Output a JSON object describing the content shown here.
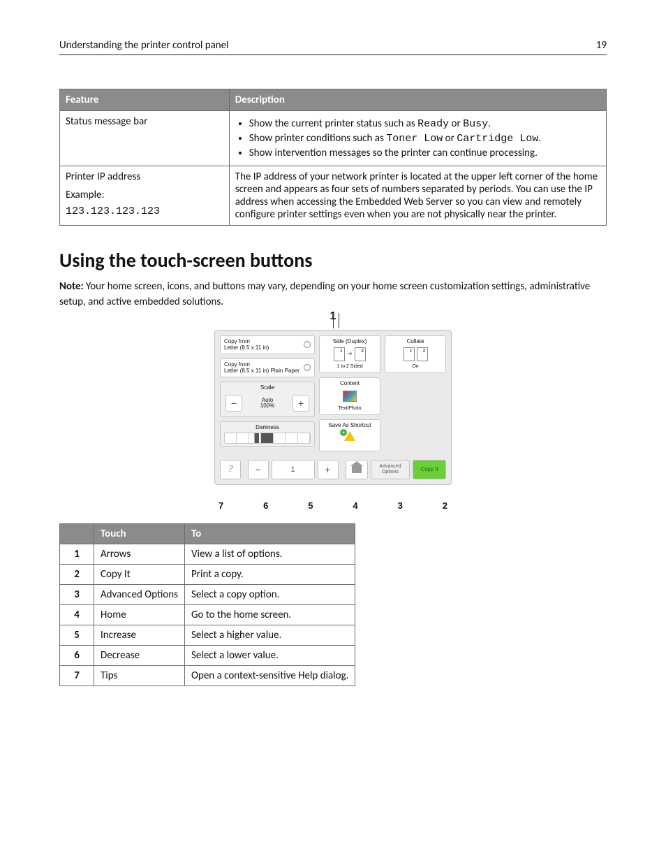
{
  "header": {
    "title": "Understanding the printer control panel",
    "page_no": "19"
  },
  "feature_table": {
    "head": {
      "feature": "Feature",
      "description": "Description"
    },
    "rows": [
      {
        "feature": "Status message bar",
        "bullets": [
          {
            "pre": "Show the current printer status such as ",
            "code1": "Ready",
            "mid": " or ",
            "code2": "Busy",
            "post": "."
          },
          {
            "pre": "Show printer conditions such as ",
            "code1": "Toner Low",
            "mid": " or ",
            "code2": "Cartridge Low",
            "post": "."
          },
          {
            "pre": "Show intervention messages so the printer can continue processing.",
            "code1": "",
            "mid": "",
            "code2": "",
            "post": ""
          }
        ]
      },
      {
        "feature_line1": "Printer IP address",
        "feature_line2": "Example:",
        "feature_code": "123.123.123.123",
        "desc": "The IP address of your network printer is located at the upper left corner of the home screen and appears as four sets of numbers separated by periods. You can use the IP address when accessing the Embedded Web Server so you can view and remotely configure printer settings even when you are not physically near the printer."
      }
    ]
  },
  "section_heading": "Using the touch-screen buttons",
  "note_label": "Note:",
  "note_text": " Your home screen, icons, and buttons may vary, depending on your home screen customization settings, administrative setup, and active embedded solutions.",
  "touchscreen": {
    "copy_from_1_l1": "Copy from",
    "copy_from_1_l2": "Letter (8.5 x 11 in)",
    "copy_from_2_l1": "Copy from",
    "copy_from_2_l2": "Letter (8.5 x 11 in) Plain Paper",
    "scale_label": "Scale",
    "scale_mode": "Auto",
    "scale_value": "100%",
    "darkness_label": "Darkness",
    "side_label": "Side (Duplex)",
    "side_caption": "1 to 2 Sided",
    "collate_label": "Collate",
    "collate_caption": "On",
    "content_label": "Content",
    "content_caption": "Text/Photo",
    "save_shortcut_label": "Save As Shortcut",
    "advanced_label": "Advanced Options",
    "copyit_label": "Copy It",
    "copies_value": "1",
    "minus": "−",
    "plus": "+",
    "help": "?"
  },
  "callouts": {
    "top": "1",
    "bottom": [
      "7",
      "6",
      "5",
      "4",
      "3",
      "2"
    ]
  },
  "touch_table": {
    "head": {
      "num": "",
      "touch": "Touch",
      "to": "To"
    },
    "rows": [
      {
        "n": "1",
        "touch": "Arrows",
        "to": "View a list of options."
      },
      {
        "n": "2",
        "touch": "Copy It",
        "to": "Print a copy."
      },
      {
        "n": "3",
        "touch": "Advanced Options",
        "to": "Select a copy option."
      },
      {
        "n": "4",
        "touch": "Home",
        "to": "Go to the home screen."
      },
      {
        "n": "5",
        "touch": "Increase",
        "to": "Select a higher value."
      },
      {
        "n": "6",
        "touch": "Decrease",
        "to": "Select a lower value."
      },
      {
        "n": "7",
        "touch": "Tips",
        "to": "Open a context-sensitive Help dialog."
      }
    ]
  }
}
